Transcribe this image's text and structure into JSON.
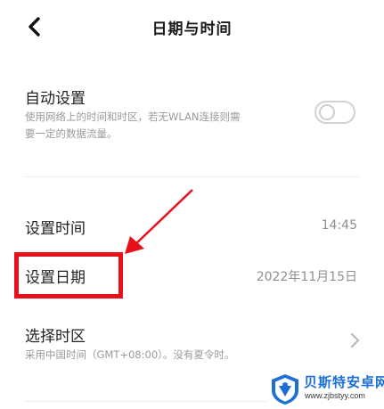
{
  "header": {
    "title": "日期与时间",
    "back_icon": "chevron-left-icon"
  },
  "auto_setting": {
    "title": "自动设置",
    "description_line1": "使用网络上的时间和时区，若无WLAN连接则需",
    "description_line2": "要一定的数据流量。",
    "toggle_state": "off"
  },
  "set_time": {
    "title": "设置时间",
    "value": "14:45"
  },
  "set_date": {
    "title": "设置日期",
    "value": "2022年11月15日"
  },
  "time_zone": {
    "title": "选择时区",
    "description": "采用中国时间（GMT+08:00）。没有夏令时。",
    "chevron_icon": "chevron-right-icon"
  },
  "annotation": {
    "color": "#e8101b"
  },
  "watermark": {
    "name": "贝斯特安卓网",
    "url": "www.zjbstyy.com",
    "brand_color": "#1c6fd6"
  }
}
